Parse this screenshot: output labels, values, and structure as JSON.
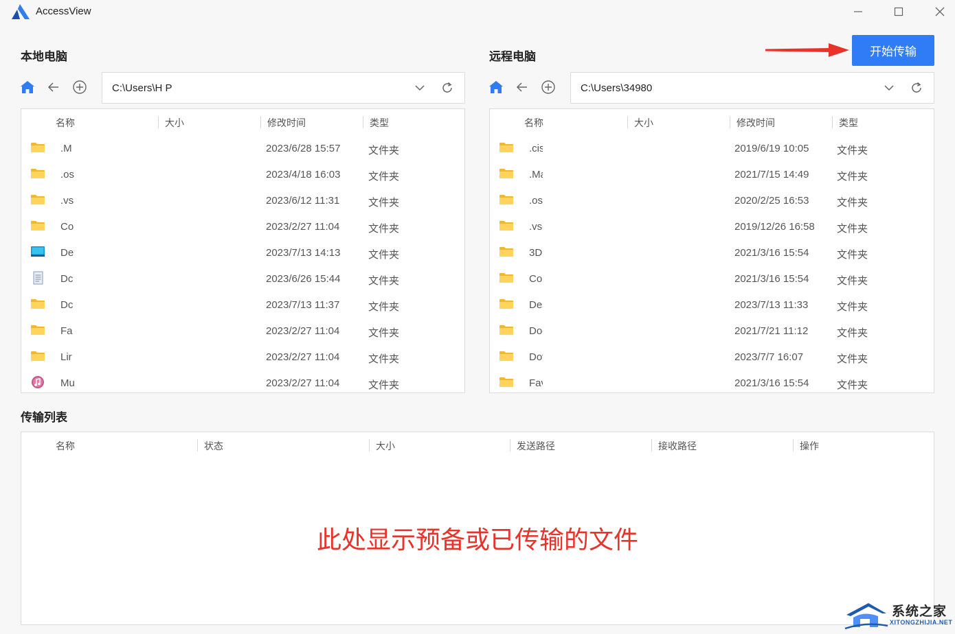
{
  "window": {
    "title": "AccessView",
    "minimize_icon": "minimize-icon",
    "maximize_icon": "maximize-icon",
    "close_icon": "close-icon"
  },
  "accent_color": "#2f7cf6",
  "start_button_label": "开始传输",
  "local": {
    "title": "本地电脑",
    "path": "C:\\Users\\H P",
    "columns": [
      "名称",
      "大小",
      "修改时间",
      "类型"
    ],
    "files": [
      {
        "name": ".M",
        "modified": "2023/6/28 15:57",
        "type": "文件夹",
        "icon": "folder-icon"
      },
      {
        "name": ".os",
        "modified": "2023/4/18 16:03",
        "type": "文件夹",
        "icon": "folder-icon"
      },
      {
        "name": ".vs",
        "modified": "2023/6/12 11:31",
        "type": "文件夹",
        "icon": "folder-icon"
      },
      {
        "name": "Co",
        "modified": "2023/2/27 11:04",
        "type": "文件夹",
        "icon": "folder-icon"
      },
      {
        "name": "De",
        "modified": "2023/7/13 14:13",
        "type": "文件夹",
        "icon": "desktop-icon"
      },
      {
        "name": "Dc",
        "modified": "2023/6/26 15:44",
        "type": "文件夹",
        "icon": "document-icon"
      },
      {
        "name": "Dc",
        "modified": "2023/7/13 11:37",
        "type": "文件夹",
        "icon": "folder-icon"
      },
      {
        "name": "Fa",
        "modified": "2023/2/27 11:04",
        "type": "文件夹",
        "icon": "folder-icon"
      },
      {
        "name": "Lir",
        "modified": "2023/2/27 11:04",
        "type": "文件夹",
        "icon": "folder-icon"
      },
      {
        "name": "Mu",
        "modified": "2023/2/27 11:04",
        "type": "文件夹",
        "icon": "music-icon"
      }
    ]
  },
  "remote": {
    "title": "远程电脑",
    "path": "C:\\Users\\34980",
    "columns": [
      "名称",
      "大小",
      "修改时间",
      "类型"
    ],
    "files": [
      {
        "name": ".cisc",
        "modified": "2019/6/19 10:05",
        "type": "文件夹",
        "icon": "folder-icon"
      },
      {
        "name": ".Ma",
        "modified": "2021/7/15 14:49",
        "type": "文件夹",
        "icon": "folder-icon"
      },
      {
        "name": ".oss",
        "modified": "2020/2/25 16:53",
        "type": "文件夹",
        "icon": "folder-icon"
      },
      {
        "name": ".vsc",
        "modified": "2019/12/26 16:58",
        "type": "文件夹",
        "icon": "folder-icon"
      },
      {
        "name": "3D",
        "modified": "2021/3/16 15:54",
        "type": "文件夹",
        "icon": "folder-icon"
      },
      {
        "name": "Cor",
        "modified": "2021/3/16 15:54",
        "type": "文件夹",
        "icon": "folder-icon"
      },
      {
        "name": "Des",
        "modified": "2023/7/13 11:33",
        "type": "文件夹",
        "icon": "folder-icon"
      },
      {
        "name": "Doc",
        "modified": "2021/7/21 11:12",
        "type": "文件夹",
        "icon": "folder-icon"
      },
      {
        "name": "Dov",
        "modified": "2023/7/7 16:07",
        "type": "文件夹",
        "icon": "folder-icon"
      },
      {
        "name": "Fav",
        "modified": "2021/3/16 15:54",
        "type": "文件夹",
        "icon": "folder-icon"
      }
    ]
  },
  "transfer": {
    "title": "传输列表",
    "columns": [
      "名称",
      "状态",
      "大小",
      "发送路径",
      "接收路径",
      "操作"
    ],
    "hint": "此处显示预备或已传输的文件"
  },
  "watermark": {
    "text": "系统之家",
    "sub": "XITONGZHIJIA.NET"
  }
}
